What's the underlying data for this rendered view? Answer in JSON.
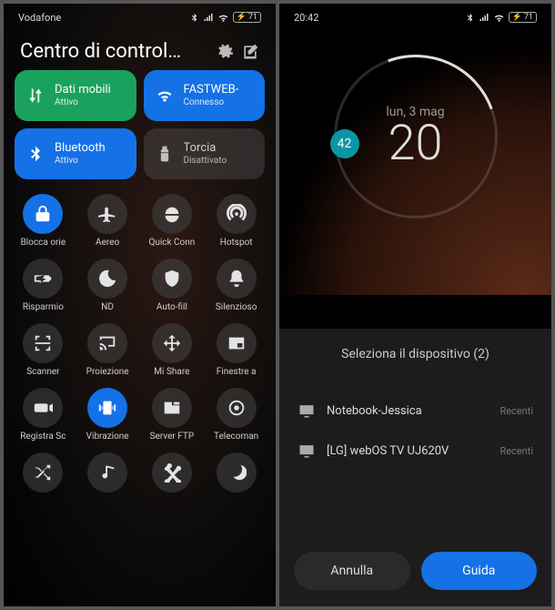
{
  "left": {
    "carrier": "Vodafone",
    "battery": "71",
    "title": "Centro di control…",
    "tiles": [
      {
        "name": "Dati mobili",
        "status": "Attivo",
        "icon": "data-arrows",
        "color": "green"
      },
      {
        "name": "FASTWEB-",
        "status": "Connesso",
        "icon": "wifi",
        "color": "blue"
      },
      {
        "name": "Bluetooth",
        "status": "Attivo",
        "icon": "bluetooth",
        "color": "blue"
      },
      {
        "name": "Torcia",
        "status": "Disattivato",
        "icon": "flashlight",
        "color": "gray"
      }
    ],
    "qs": [
      {
        "label": "Blocca orie",
        "icon": "lock-rotate",
        "accent": true
      },
      {
        "label": "Aereo",
        "icon": "airplane"
      },
      {
        "label": "Quick Conn",
        "icon": "vpn"
      },
      {
        "label": "Hotspot",
        "icon": "hotspot"
      },
      {
        "label": "Risparmio",
        "icon": "battery-save"
      },
      {
        "label": "ND",
        "icon": "moon"
      },
      {
        "label": "Auto-fill",
        "icon": "shield"
      },
      {
        "label": "Silenzioso",
        "icon": "bell"
      },
      {
        "label": "Scanner",
        "icon": "scanner"
      },
      {
        "label": "Proiezione",
        "icon": "cast"
      },
      {
        "label": "Mi Share",
        "icon": "mishare"
      },
      {
        "label": "Finestre a",
        "icon": "pip"
      },
      {
        "label": "Registra Sc",
        "icon": "camera"
      },
      {
        "label": "Vibrazione",
        "icon": "vibrate",
        "accent": true
      },
      {
        "label": "Server FTP",
        "icon": "ftp"
      },
      {
        "label": "Telecoman",
        "icon": "remote"
      },
      {
        "label": "",
        "icon": "shuffle"
      },
      {
        "label": "",
        "icon": "music"
      },
      {
        "label": "",
        "icon": "scissors"
      },
      {
        "label": "",
        "icon": "night"
      }
    ]
  },
  "right": {
    "time": "20:42",
    "battery": "71",
    "widget": {
      "date": "lun, 3 mag",
      "hour": "20",
      "seconds": "42"
    },
    "cast": {
      "title": "Seleziona il dispositivo (2)",
      "devices": [
        {
          "name": "Notebook-Jessica",
          "tag": "Recenti",
          "type": "monitor"
        },
        {
          "name": "[LG] webOS TV UJ620V",
          "tag": "Recenti",
          "type": "monitor"
        }
      ],
      "cancel": "Annulla",
      "guide": "Guida"
    }
  }
}
